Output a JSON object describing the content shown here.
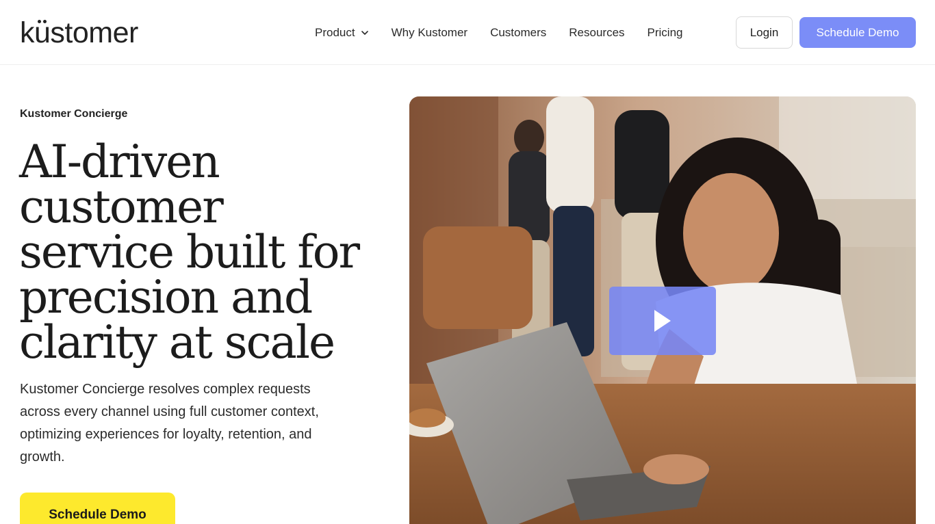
{
  "header": {
    "logo": "kustomer",
    "nav": [
      {
        "label": "Product",
        "has_dropdown": true
      },
      {
        "label": "Why Kustomer"
      },
      {
        "label": "Customers"
      },
      {
        "label": "Resources"
      },
      {
        "label": "Pricing"
      }
    ],
    "login_label": "Login",
    "demo_label": "Schedule Demo"
  },
  "hero": {
    "eyebrow": "Kustomer Concierge",
    "headline": "AI-driven customer service built for precision and clarity at scale",
    "description": "Kustomer Concierge resolves complex requests across every channel using full customer context, optimizing experiences for loyalty, retention, and growth.",
    "cta_label": "Schedule Demo"
  },
  "media": {
    "play_icon": "play-icon"
  },
  "colors": {
    "accent": "#7b8df7",
    "cta": "#fde92d",
    "text": "#1c1c1c"
  }
}
